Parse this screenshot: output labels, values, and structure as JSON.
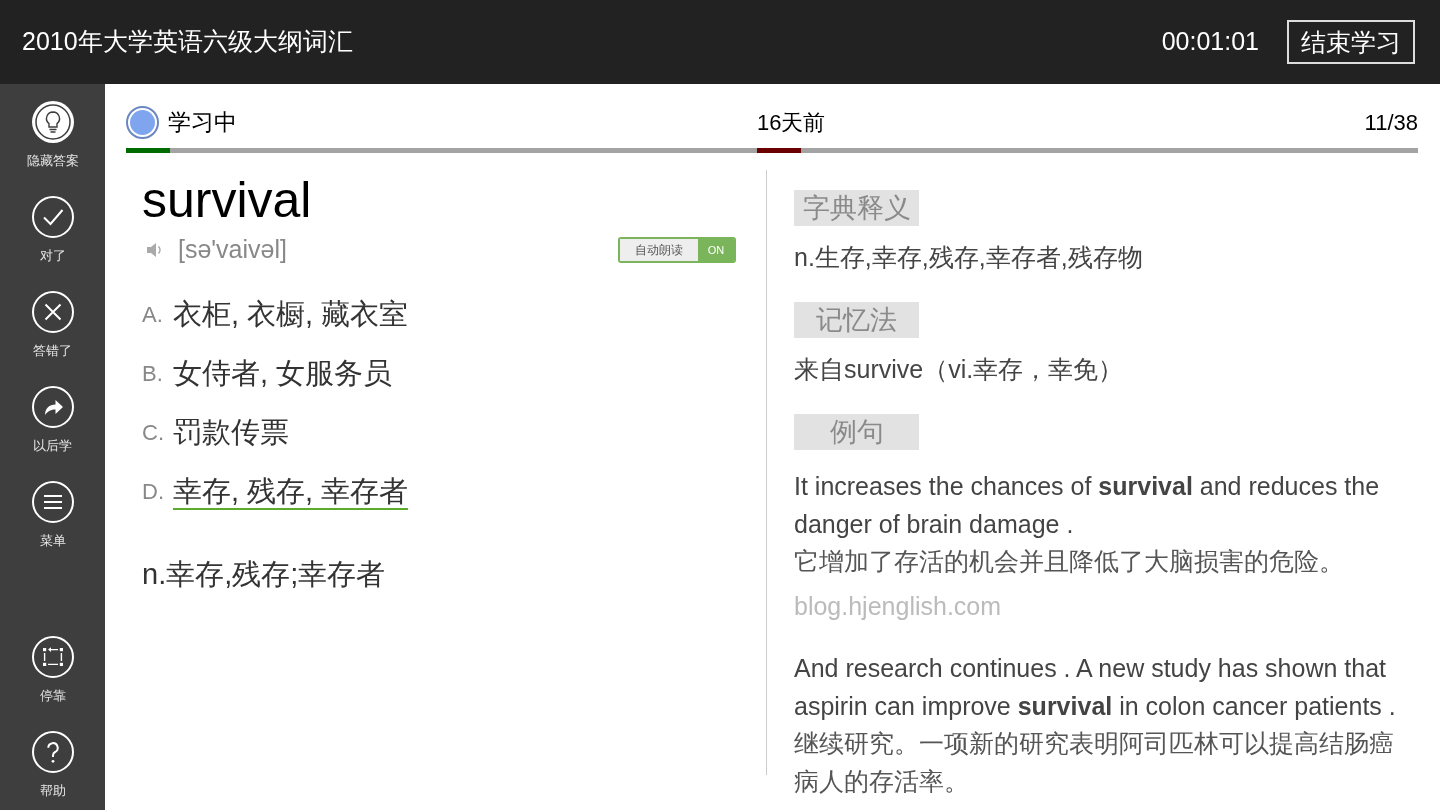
{
  "top_bar": {
    "title": "2010年大学英语六级大纲词汇",
    "timer": "00:01:01",
    "end_button": "结束学习"
  },
  "sidebar": {
    "top_items": [
      {
        "label": "隐藏答案",
        "kind": "bulb"
      },
      {
        "label": "对了",
        "kind": "check"
      },
      {
        "label": "答错了",
        "kind": "cross"
      },
      {
        "label": "以后学",
        "kind": "later"
      },
      {
        "label": "菜单",
        "kind": "menu"
      }
    ],
    "bottom_items": [
      {
        "label": "停靠",
        "kind": "dock"
      },
      {
        "label": "帮助",
        "kind": "help"
      }
    ]
  },
  "status": {
    "markers": [
      {
        "label": "学习中",
        "kind": "status",
        "color": "#006b00"
      },
      {
        "label": "16天前",
        "kind": "time",
        "color": "#6b0000"
      }
    ],
    "count": "11/38"
  },
  "word": {
    "text": "survival",
    "phonetic": "[sə'vaivəl]",
    "auto_read": {
      "label": "自动朗读",
      "state": "ON",
      "on": true
    }
  },
  "options": [
    {
      "letter": "A.",
      "text": "衣柜, 衣橱, 藏衣室",
      "correct": false
    },
    {
      "letter": "B.",
      "text": "女侍者, 女服务员",
      "correct": false
    },
    {
      "letter": "C.",
      "text": "罚款传票",
      "correct": false
    },
    {
      "letter": "D.",
      "text": "幸存, 残存, 幸存者",
      "correct": true
    }
  ],
  "answer": "n.幸存,残存;幸存者",
  "sections": [
    {
      "heading": "字典释义",
      "kind": "text",
      "text": "n.生存,幸存,残存,幸存者,残存物"
    },
    {
      "heading": "记忆法",
      "kind": "text",
      "text": "来自survive（vi.幸存，幸免）"
    },
    {
      "heading": "例句",
      "kind": "examples",
      "examples": [
        {
          "en": "It increases the chances of **survival** and reduces the danger of brain damage .",
          "zh": "它增加了存活的机会并且降低了大脑损害的危险。",
          "source": "blog.hjenglish.com"
        },
        {
          "en": "And research continues . A new study has shown that aspirin can improve **survival** in colon cancer patients .",
          "zh": "继续研究。一项新的研究表明阿司匹林可以提高结肠癌病人的存活率。"
        }
      ]
    }
  ]
}
